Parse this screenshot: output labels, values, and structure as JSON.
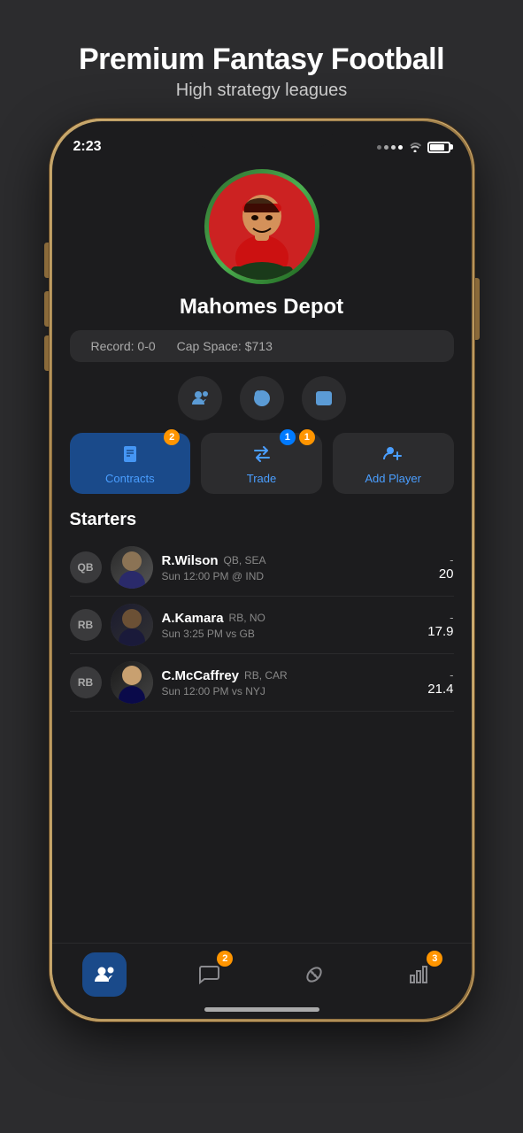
{
  "page": {
    "background": "#2c2c2e",
    "header": {
      "title": "Premium Fantasy Football",
      "subtitle": "High strategy leagues"
    }
  },
  "status_bar": {
    "time": "2:23",
    "wifi": true,
    "battery": 80
  },
  "team": {
    "name": "Mahomes Depot",
    "record_label": "Record: 0-0",
    "cap_space_label": "Cap Space: $713"
  },
  "action_buttons": [
    {
      "label": "Contracts",
      "badge": "2",
      "badge_color": "orange",
      "active": true
    },
    {
      "label": "Trade",
      "badge_top": "1",
      "badge_side": "1",
      "badge_color": "blue",
      "active": false
    },
    {
      "label": "Add Player",
      "active": false
    }
  ],
  "starters": {
    "label": "Starters",
    "players": [
      {
        "position": "QB",
        "name": "R.Wilson",
        "pos_team": "QB, SEA",
        "game": "Sun 12:00 PM @ IND",
        "score_dash": "-",
        "score": "20"
      },
      {
        "position": "RB",
        "name": "A.Kamara",
        "pos_team": "RB, NO",
        "game": "Sun 3:25 PM vs GB",
        "score_dash": "-",
        "score": "17.9"
      },
      {
        "position": "RB",
        "name": "C.McCaffrey",
        "pos_team": "RB, CAR",
        "game": "Sun 12:00 PM vs NYJ",
        "score_dash": "-",
        "score": "21.4"
      }
    ]
  },
  "tab_bar": {
    "tabs": [
      {
        "id": "roster",
        "active": true,
        "badge": null
      },
      {
        "id": "chat",
        "active": false,
        "badge": "2"
      },
      {
        "id": "ball",
        "active": false,
        "badge": null
      },
      {
        "id": "stats",
        "active": false,
        "badge": "3"
      }
    ]
  }
}
